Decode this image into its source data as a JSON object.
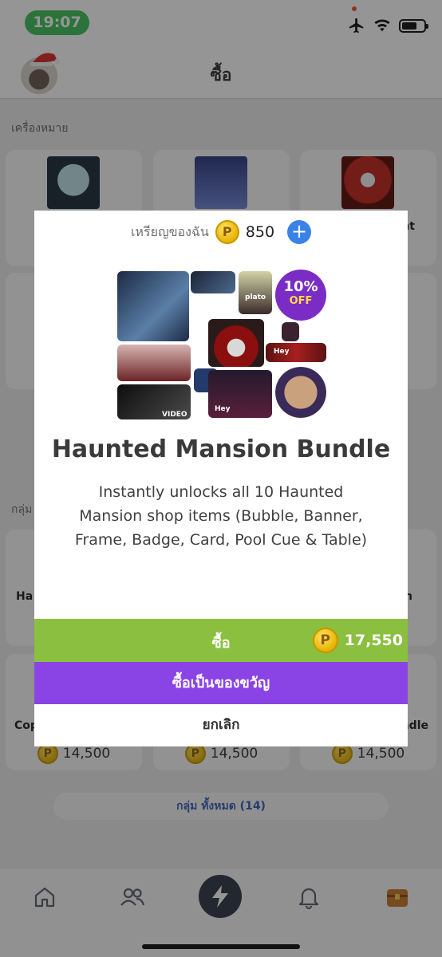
{
  "status": {
    "time": "19:07"
  },
  "header": {
    "title": "ซื้อ"
  },
  "section_items": "เครื่องหมาย",
  "section_bundles": "กลุ่ม",
  "partial_labels": {
    "row1_right": "nt",
    "row3_left": "Ha",
    "row3_right": "n",
    "row4_left": "Cop",
    "row4_right": "ndle"
  },
  "prices": [
    "14,500",
    "14,500",
    "14,500"
  ],
  "all_groups_label": "กลุ่ม ทั้งหมด (14)",
  "modal": {
    "balance_label": "เหรียญของฉัน",
    "coin_symbol": "P",
    "balance": "850",
    "add_symbol": "+",
    "sale_percent": "10%",
    "sale_off": "OFF",
    "tag_plato": "plato",
    "tag_hey": "Hey",
    "tag_hey2": "Hey",
    "tag_video": "VIDEO",
    "title": "Haunted Mansion Bundle",
    "description": "Instantly unlocks all 10 Haunted Mansion shop items (Bubble, Banner, Frame, Badge, Card, Pool Cue & Table)",
    "buy_label": "ซื้อ",
    "price": "17,550",
    "gift_label": "ซื้อเป็นของขวัญ",
    "cancel_label": "ยกเลิก"
  },
  "colors": {
    "buy_green": "#8bbf3f",
    "gift_purple": "#8a44e6",
    "sale_purple": "#7b2cc4",
    "link_blue": "#3a5fb8",
    "coin_gold": "#e8b200"
  },
  "tabs": [
    "home-icon",
    "friends-icon",
    "lightning-icon",
    "bell-icon",
    "treasure-chest-icon"
  ]
}
